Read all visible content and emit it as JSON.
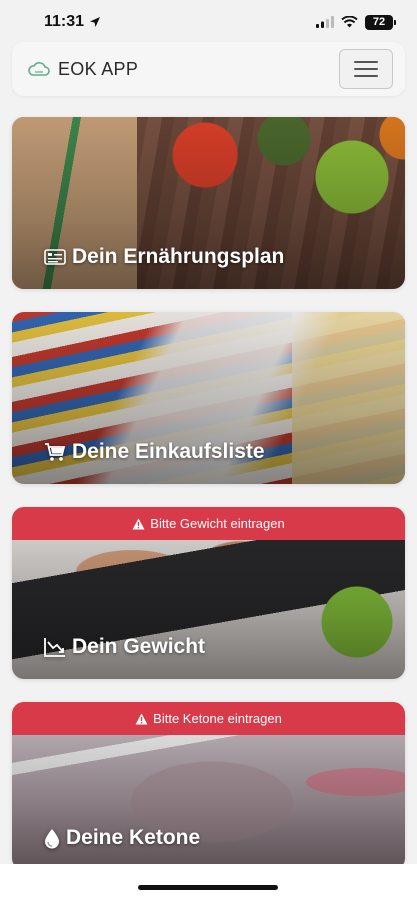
{
  "status_bar": {
    "time": "11:31",
    "battery": "72",
    "icons": [
      "location-arrow-icon",
      "cellular-signal-icon",
      "wifi-icon",
      "battery-icon"
    ]
  },
  "navbar": {
    "brand_icon": "cloud-icon",
    "brand_name": "EOK APP",
    "menu_icon": "hamburger-menu-icon"
  },
  "cards": [
    {
      "title": "Dein Ernährungsplan",
      "icon": "plan-list-icon",
      "alert": null
    },
    {
      "title": "Deine Einkaufsliste",
      "icon": "shopping-cart-icon",
      "alert": null
    },
    {
      "title": "Dein Gewicht",
      "icon": "trend-down-chart-icon",
      "alert": "Bitte Gewicht eintragen"
    },
    {
      "title": "Deine Ketone",
      "icon": "droplet-icon",
      "alert": "Bitte Ketone eintragen"
    }
  ],
  "colors": {
    "alert": "#d93a4a",
    "brand_icon": "#5fae8c",
    "background": "#f2f2f3"
  }
}
